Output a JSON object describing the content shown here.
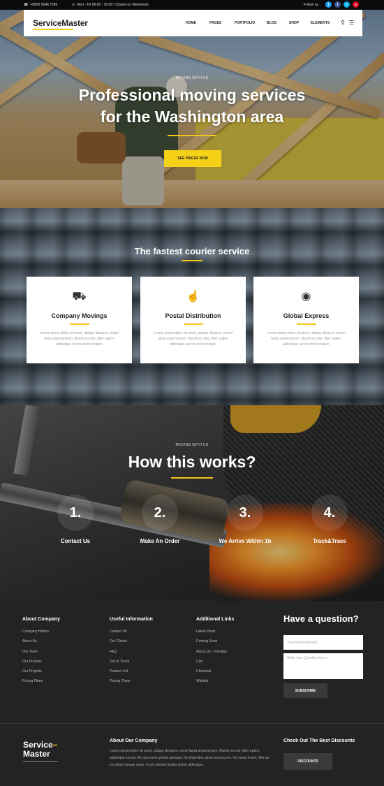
{
  "topbar": {
    "phone": "+0855 5646 7589",
    "hours": "Mon - Fri 08:00 - 20:00 / Closed on Weekends",
    "follow_label": "Follow us",
    "social": [
      {
        "name": "twitter",
        "glyph": "t",
        "color": "#1da1f2"
      },
      {
        "name": "facebook",
        "glyph": "f",
        "color": "#3b5998"
      },
      {
        "name": "skype",
        "glyph": "s",
        "color": "#00aff0"
      },
      {
        "name": "pinterest",
        "glyph": "p",
        "color": "#e60023"
      }
    ]
  },
  "header": {
    "logo": "ServiceMaster",
    "nav": [
      "HOME",
      "PAGES",
      "PORTFOLIO",
      "BLOG",
      "SHOP",
      "ELEMENTS"
    ]
  },
  "hero": {
    "subtitle": "MOVING WITH US",
    "title_line1": "Professional moving services",
    "title_line2": "for the Washington area",
    "button": "SEE PRICES NOW"
  },
  "services": {
    "title": "The fastest courier service",
    "cards": [
      {
        "icon": "truck-icon",
        "title": "Company Movings",
        "text": "Lorem ipsum dolor sit amet, ubique dictas in semel tanta argumentum. Mundi eu sea, liber option aldenique sercivi dolor enipuit."
      },
      {
        "icon": "thumbs-up-icon",
        "title": "Postal Distribution",
        "text": "Lorem ipsum dolor sit amet, ubique dictas in semel tanta argumentum. Mundi eu sea, liber option aldenique sercivi dolor enipuit."
      },
      {
        "icon": "globe-icon",
        "title": "Global Express",
        "text": "Lorem ipsum dolor sit amet, ubique dictas in semel tanta argumentum. Mundi eu sea, liber option aldenique sercivi dolor enipuit."
      }
    ]
  },
  "works": {
    "subtitle": "MOVING WITH US",
    "title": "How this works?",
    "steps": [
      {
        "number": "1.",
        "label": "Contact Us"
      },
      {
        "number": "2.",
        "label": "Make An Order"
      },
      {
        "number": "3.",
        "label": "We Arrive Within 1h"
      },
      {
        "number": "4.",
        "label": "Track&Trace"
      }
    ]
  },
  "footer": {
    "columns": [
      {
        "title": "About Company",
        "items": [
          "Company History",
          "About Us",
          "Our Team",
          "Our Process",
          "Our Projects",
          "Pricing Plans"
        ]
      },
      {
        "title": "Useful Information",
        "items": [
          "Contact Us",
          "Our Clients",
          "FAQ",
          "Get In Touch",
          "Product List",
          "Pricing Plans"
        ]
      },
      {
        "title": "Additional Links",
        "items": [
          "Latest Posts",
          "Coming Soon",
          "About Us – Parallax",
          "Cart",
          "Checkout",
          "Wishlist"
        ]
      }
    ],
    "question": {
      "title": "Have a question?",
      "email_placeholder": "Your Email Address",
      "question_placeholder": "Write your Question here...",
      "button": "SUBSCRIBE"
    },
    "bottom": {
      "logo_line1": "Service",
      "logo_sup": "WP",
      "logo_line2": "Master",
      "about_title": "About Our Company",
      "about_text": "Lorem ipsum dolor sit amet, ubique dictas in semel tanta argumentum. Mundi eu sea, liber option aldenique sercivi. An duo lorem primis gloriatur. No imperdiet adver sarium pro. Vix sumo lorem. Mei ea eu simul conque untur. In vel nemore facilis option aldenique.",
      "discounts_title": "Check Out The Best Discounts",
      "discounts_button": "DISCOUNTS"
    }
  }
}
